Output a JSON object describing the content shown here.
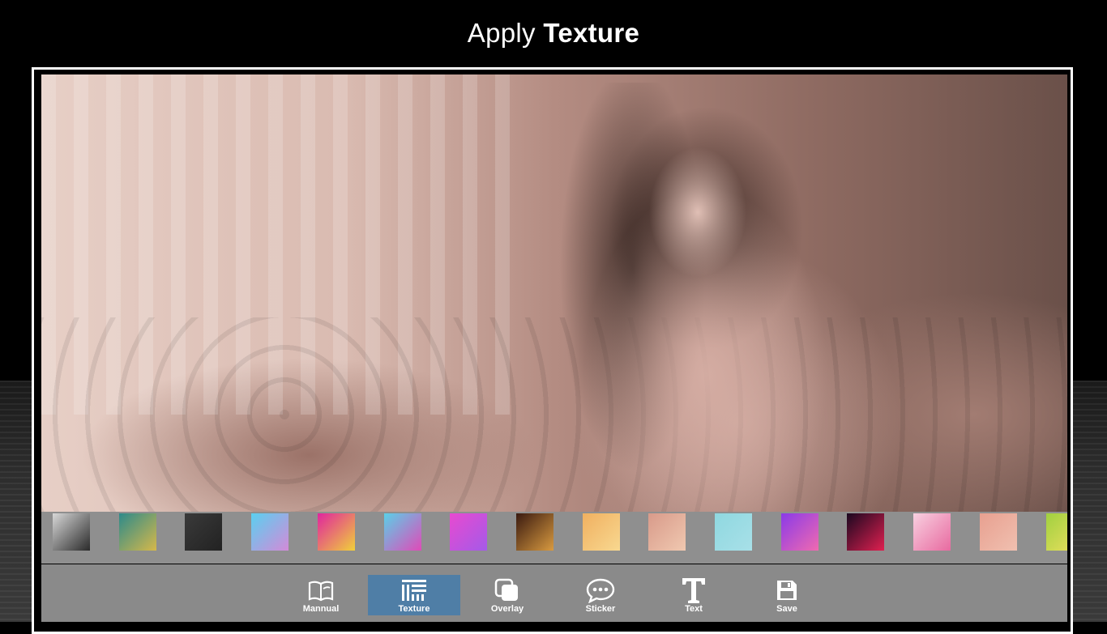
{
  "header": {
    "title_prefix": "Apply",
    "title_bold": "Texture"
  },
  "thumbnails": [
    {
      "name": "texture-thumb-portrait",
      "colors": [
        "#d8d8d8",
        "#2a2a2a"
      ]
    },
    {
      "name": "texture-thumb-bokeh-green",
      "colors": [
        "#2d8a8a",
        "#d6b84a"
      ]
    },
    {
      "name": "texture-thumb-dark-grid",
      "colors": [
        "#3a3a3a",
        "#222222"
      ]
    },
    {
      "name": "texture-thumb-sky-blue",
      "colors": [
        "#5ad0f0",
        "#d38ad8"
      ]
    },
    {
      "name": "texture-thumb-rainbow-poly",
      "colors": [
        "#e0259e",
        "#f0d03a"
      ]
    },
    {
      "name": "texture-thumb-cyan-poly",
      "colors": [
        "#5ad0e8",
        "#e04ab8"
      ]
    },
    {
      "name": "texture-thumb-pink-poly",
      "colors": [
        "#e84ad0",
        "#a45ae8"
      ]
    },
    {
      "name": "texture-thumb-gold-lights",
      "colors": [
        "#3a1a10",
        "#d89a40"
      ]
    },
    {
      "name": "texture-thumb-orange-gradient",
      "colors": [
        "#f0b060",
        "#f8d890"
      ]
    },
    {
      "name": "texture-thumb-peach-bokeh",
      "colors": [
        "#d89a8a",
        "#f0c8b0"
      ]
    },
    {
      "name": "texture-thumb-light-cyan",
      "colors": [
        "#8fd8e0",
        "#a8e0e8"
      ]
    },
    {
      "name": "texture-thumb-purple-poly",
      "colors": [
        "#8a3ae8",
        "#f06ab0"
      ]
    },
    {
      "name": "texture-thumb-red-galaxy",
      "colors": [
        "#1a0820",
        "#e02050"
      ]
    },
    {
      "name": "texture-thumb-pink-splash",
      "colors": [
        "#f8d0e0",
        "#e86aa0"
      ]
    },
    {
      "name": "texture-thumb-peach-poly",
      "colors": [
        "#e8a090",
        "#f0c0b0"
      ]
    },
    {
      "name": "texture-thumb-lime-poly",
      "colors": [
        "#a0d040",
        "#f0e060"
      ]
    }
  ],
  "toolbar": {
    "mannual": "Mannual",
    "texture": "Texture",
    "overlay": "Overlay",
    "sticker": "Sticker",
    "text": "Text",
    "save": "Save",
    "active_color": "#4f7ea6"
  }
}
